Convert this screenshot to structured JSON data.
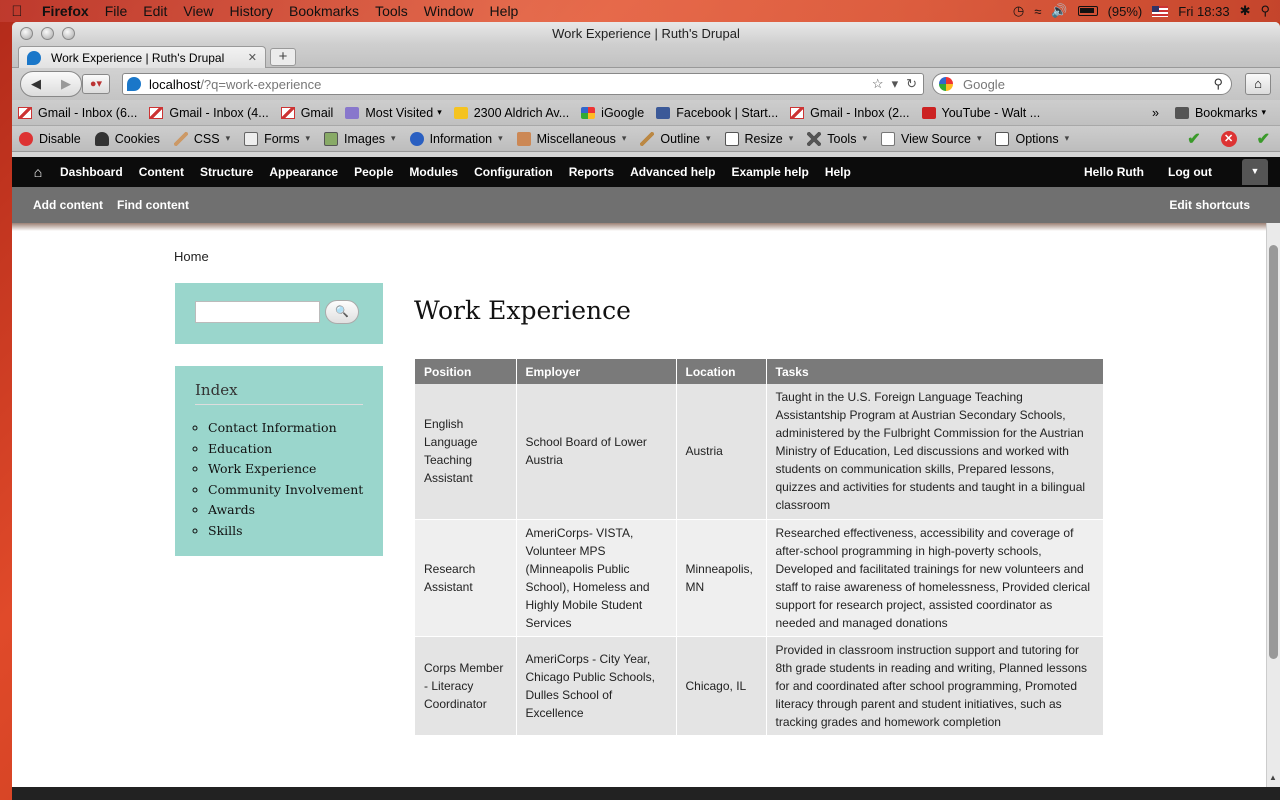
{
  "menubar": {
    "app": "Firefox",
    "items": [
      "File",
      "Edit",
      "View",
      "History",
      "Bookmarks",
      "Tools",
      "Window",
      "Help"
    ],
    "battery": "(95%)",
    "clock": "Fri 18:33"
  },
  "window": {
    "title": "Work Experience | Ruth's Drupal"
  },
  "tab": {
    "title": "Work Experience | Ruth's Drupal"
  },
  "address": {
    "host": "localhost",
    "path": "/?q=work-experience"
  },
  "search": {
    "placeholder": "Google"
  },
  "bookmarks": [
    {
      "label": "Gmail - Inbox (6...",
      "icon": "gmail-icon"
    },
    {
      "label": "Gmail - Inbox (4...",
      "icon": "gmail-icon"
    },
    {
      "label": "Gmail",
      "icon": "gmail-icon"
    },
    {
      "label": "Most Visited",
      "icon": "folder-icon"
    },
    {
      "label": "2300 Aldrich Av...",
      "icon": "maps-icon"
    },
    {
      "label": "iGoogle",
      "icon": "igoogle-icon"
    },
    {
      "label": "Facebook | Start...",
      "icon": "facebook-icon"
    },
    {
      "label": "Gmail - Inbox (2...",
      "icon": "gmail-icon"
    },
    {
      "label": "YouTube - Walt ...",
      "icon": "youtube-icon"
    }
  ],
  "bookmarks_menu": "Bookmarks",
  "devtoolbar": [
    "Disable",
    "Cookies",
    "CSS",
    "Forms",
    "Images",
    "Information",
    "Miscellaneous",
    "Outline",
    "Resize",
    "Tools",
    "View Source",
    "Options"
  ],
  "drupal_toolbar": {
    "links": [
      "Dashboard",
      "Content",
      "Structure",
      "Appearance",
      "People",
      "Modules",
      "Configuration",
      "Reports",
      "Advanced help",
      "Example help",
      "Help"
    ],
    "hello": "Hello Ruth",
    "logout": "Log out"
  },
  "shortcuts": {
    "add": "Add content",
    "find": "Find content",
    "edit": "Edit shortcuts"
  },
  "breadcrumb": "Home",
  "sidebar": {
    "index_title": "Index",
    "index_items": [
      "Contact Information",
      "Education",
      "Work Experience",
      "Community Involvement",
      "Awards",
      "Skills"
    ]
  },
  "page_title": "Work Experience",
  "table": {
    "headers": [
      "Position",
      "Employer",
      "Location",
      "Tasks"
    ],
    "rows": [
      [
        "English Language Teaching Assistant",
        "School Board of Lower Austria",
        "Austria",
        "Taught in the U.S. Foreign Language Teaching Assistantship Program at Austrian Secondary Schools, administered by the Fulbright Commission for the Austrian Ministry of Education, Led discussions and worked with students on communication skills, Prepared lessons, quizzes and activities for students and taught in a bilingual classroom"
      ],
      [
        "Research Assistant",
        "AmeriCorps- VISTA, Volunteer MPS (Minneapolis Public School), Homeless and Highly Mobile Student Services",
        "Minneapolis, MN",
        "Researched effectiveness, accessibility and coverage of after-school programming in high-poverty schools, Developed and facilitated trainings for new volunteers and staff to raise awareness of homelessness, Provided clerical support for research project, assisted coordinator as needed and managed donations"
      ],
      [
        "Corps Member - Literacy Coordinator",
        "AmeriCorps - City Year, Chicago Public Schools, Dulles School of Excellence",
        "Chicago, IL",
        "Provided in classroom instruction support and tutoring for 8th grade students in reading and writing, Planned lessons for and coordinated after school programming, Promoted literacy through parent and student initiatives, such as tracking grades and homework completion"
      ]
    ]
  }
}
